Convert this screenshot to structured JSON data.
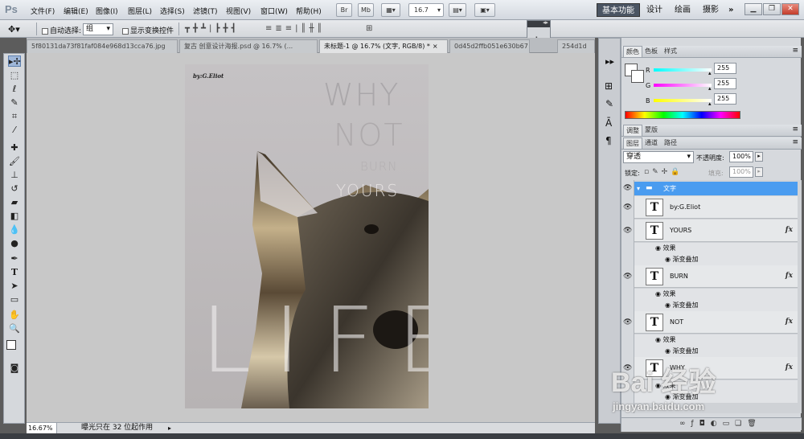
{
  "menubar": {
    "logo": "Ps",
    "items": [
      "文件(F)",
      "编辑(E)",
      "图像(I)",
      "图层(L)",
      "选择(S)",
      "滤镜(T)",
      "视图(V)",
      "窗口(W)",
      "帮助(H)"
    ],
    "br_label": "Br",
    "mb_label": "Mb",
    "zoom": "16.7",
    "workspaces": [
      "基本功能",
      "设计",
      "绘画",
      "摄影"
    ],
    "more": "»"
  },
  "options": {
    "auto_select": "自动选择:",
    "group_value": "组",
    "show_transform": "显示变换控件"
  },
  "tabs": [
    {
      "label": "5f80131da73f81faf084e968d13cca76.jpg",
      "active": false
    },
    {
      "label": "复古 创意设计海报.psd @ 16.7% (...",
      "active": false
    },
    {
      "label": "未标题-1 @ 16.7% (文字, RGB/8) *",
      "active": true
    },
    {
      "label": "0d45d2ffb051e630b67",
      "active": false
    },
    {
      "label": "254d1d",
      "active": false
    }
  ],
  "poster": {
    "byline": "by:G.Eliot",
    "why": "WHY",
    "not": "NOT",
    "burn": "BURN",
    "yours": "YOURS",
    "life": "LIFE"
  },
  "status": {
    "zoom": "16.67%",
    "message": "曝光只在 32 位起作用"
  },
  "color_panel": {
    "tabs": [
      "颜色",
      "色板",
      "样式"
    ],
    "r_label": "R",
    "g_label": "G",
    "b_label": "B",
    "r": "255",
    "g": "255",
    "b": "255",
    "r_level": 1.0,
    "g_level": 1.0,
    "b_level": 1.0
  },
  "adjust_panel": {
    "tabs": [
      "调整",
      "蒙版"
    ]
  },
  "layers_panel": {
    "tabs": [
      "图层",
      "通道",
      "路径"
    ],
    "blend_mode": "穿透",
    "opacity_label": "不透明度:",
    "opacity": "100%",
    "lock_label": "锁定:",
    "fill_label": "填充:",
    "fill": "100%",
    "group_name": "文字",
    "effects_label": "效果",
    "gradient_label": "渐变叠加",
    "layers": [
      {
        "name": "by:G.Eliot",
        "fx": ""
      },
      {
        "name": "YOURS",
        "fx": "fx"
      },
      {
        "name": "BURN",
        "fx": "fx"
      },
      {
        "name": "NOT",
        "fx": "fx"
      },
      {
        "name": "WHY",
        "fx": "fx"
      }
    ]
  },
  "watermark": {
    "text": "Bai 经验",
    "url": "jingyan.baidu.com"
  },
  "colors": {
    "accent": "#3a8ee6",
    "selected_layer": "#4a9cf0"
  }
}
